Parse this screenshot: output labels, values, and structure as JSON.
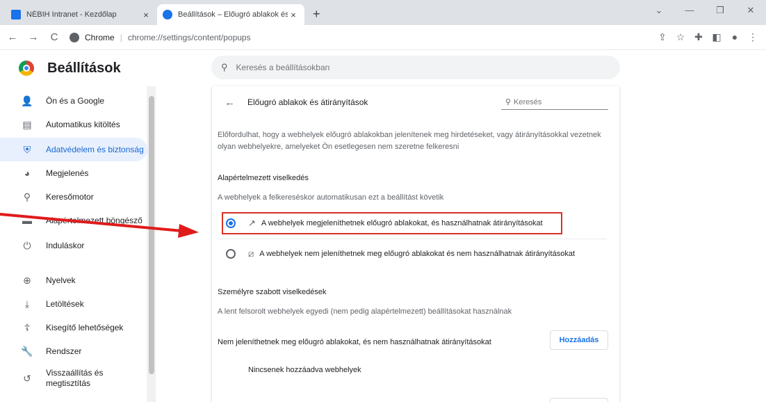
{
  "tabs": [
    {
      "title": "NÉBIH Intranet - Kezdőlap",
      "close": "×"
    },
    {
      "title": "Beállítások – Előugró ablakok és…",
      "close": "×"
    }
  ],
  "new_tab": "+",
  "window_controls": {
    "dropdown": "⌄",
    "minimize": "—",
    "restore": "❐",
    "close": "✕"
  },
  "toolbar": {
    "back": "←",
    "forward": "→",
    "reload": "C",
    "site_label": "Chrome",
    "url_host": "chrome://settings",
    "url_path": "/content/popups"
  },
  "app_title": "Beállítások",
  "search": {
    "placeholder": "Keresés a beállításokban"
  },
  "sidebar": {
    "items": [
      {
        "label": "Ön és a Google",
        "icon": "person-icon"
      },
      {
        "label": "Automatikus kitöltés",
        "icon": "clipboard-icon"
      },
      {
        "label": "Adatvédelem és biztonság",
        "icon": "shield-icon"
      },
      {
        "label": "Megjelenés",
        "icon": "palette-icon"
      },
      {
        "label": "Keresőmotor",
        "icon": "search-icon"
      },
      {
        "label": "Alapértelmezett böngésző",
        "icon": "browser-icon"
      },
      {
        "label": "Induláskor",
        "icon": "power-icon"
      },
      {
        "label": "Nyelvek",
        "icon": "globe-icon"
      },
      {
        "label": "Letöltések",
        "icon": "download-icon"
      },
      {
        "label": "Kisegítő lehetőségek",
        "icon": "accessibility-icon"
      },
      {
        "label": "Rendszer",
        "icon": "wrench-icon"
      },
      {
        "label": "Visszaállítás és megtisztítás",
        "icon": "restore-icon"
      }
    ]
  },
  "page": {
    "title": "Előugró ablakok és átirányítások",
    "search_placeholder": "Keresés",
    "description": "Előfordulhat, hogy a webhelyek előugró ablakokban jelenítenek meg hirdetéseket, vagy átirányításokkal vezetnek olyan webhelyekre, amelyeket Ön esetlegesen nem szeretne felkeresni",
    "default_section": {
      "heading": "Alapértelmezett viselkedés",
      "subtitle": "A webhelyek a felkereséskor automatikusan ezt a beállítást követik",
      "options": [
        {
          "label": "A webhelyek megjeleníthetnek előugró ablakokat, és használhatnak átirányításokat",
          "selected": true
        },
        {
          "label": "A webhelyek nem jeleníthetnek meg előugró ablakokat és nem használhatnak átirányításokat",
          "selected": false
        }
      ]
    },
    "custom_section": {
      "heading": "Személyre szabott viselkedések",
      "subtitle": "A lent felsorolt webhelyek egyedi (nem pedig alapértelmezett) beállításokat használnak",
      "blocked_label": "Nem jeleníthetnek meg előugró ablakokat, és nem használhatnak átirányításokat",
      "add_button": "Hozzáadás",
      "empty_text": "Nincsenek hozzáadva webhelyek"
    }
  },
  "colors": {
    "accent": "#1a73e8",
    "highlight": "#d93025",
    "active_nav_bg": "#e8f0fe"
  }
}
